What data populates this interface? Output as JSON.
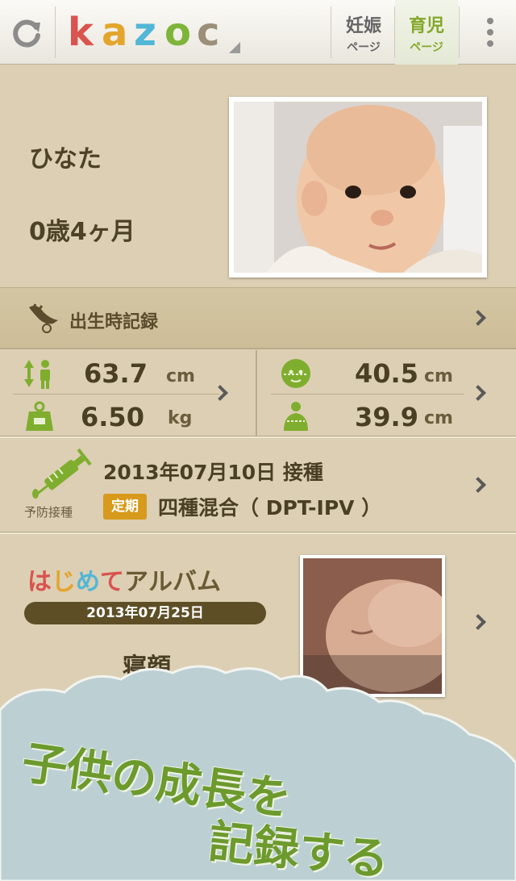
{
  "header": {
    "logo_letters": [
      "k",
      "a",
      "z",
      "o",
      "c"
    ],
    "logo_colors": [
      "#d9534f",
      "#e3a52c",
      "#52b6d6",
      "#7fb43a",
      "#9b8f7a"
    ],
    "tabs": [
      {
        "line1": "妊娠",
        "line2": "ページ"
      },
      {
        "line1": "育児",
        "line2": "ページ"
      }
    ],
    "accent_color": "#84a82a",
    "icons": {
      "refresh": "refresh-icon",
      "menu": "overflow-menu-icon"
    }
  },
  "profile": {
    "name": "ひなた",
    "age": "0歳4ヶ月"
  },
  "birth_record": {
    "label": "出生時記録",
    "icon": "stork-icon"
  },
  "measurements": {
    "height": {
      "value": "63.7",
      "unit": "cm",
      "icon": "height-icon"
    },
    "weight": {
      "value": "6.50",
      "unit": "kg",
      "icon": "scale-icon"
    },
    "head": {
      "value": "40.5",
      "unit": "cm",
      "icon": "head-circumference-icon"
    },
    "chest": {
      "value": "39.9",
      "unit": "cm",
      "icon": "chest-circumference-icon"
    }
  },
  "vaccination": {
    "label": "予防接種",
    "date": "2013年07月10日 接種",
    "badge": "定期",
    "badge_color": "#d79a1c",
    "name": "四種混合（ DPT-IPV ）",
    "icon": "syringe-icon"
  },
  "album": {
    "title_chars": [
      "は",
      "じ",
      "め",
      "て",
      "ア",
      "ル",
      "バ",
      "ム"
    ],
    "title_colors": [
      "#d9534f",
      "#e3a52c",
      "#52b6d6",
      "#d9534f",
      "#6a5a33",
      "#6a5a33",
      "#6a5a33",
      "#6a5a33"
    ],
    "date": "2013年07月25日",
    "caption": "寝顔"
  },
  "slogan": {
    "line1": "子供の成長を",
    "line2": "記録する"
  }
}
